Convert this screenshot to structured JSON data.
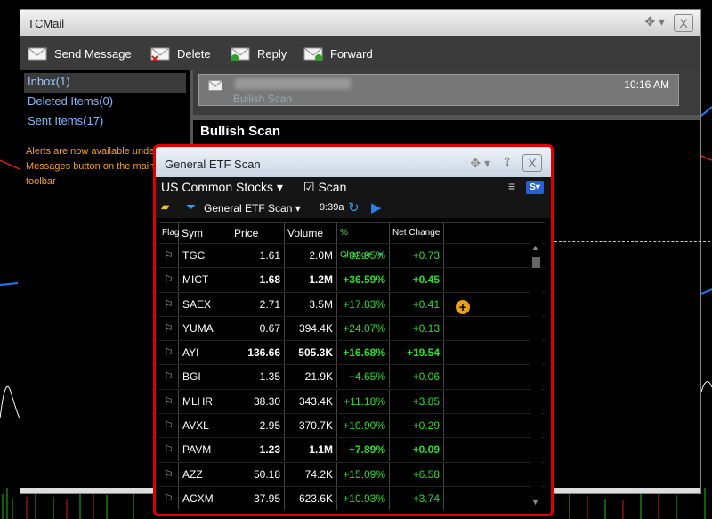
{
  "mail_window": {
    "title": "TCMail",
    "toolbar": {
      "send": "Send Message",
      "delete": "Delete",
      "reply": "Reply",
      "forward": "Forward"
    },
    "folders": [
      {
        "label": "Inbox(1)",
        "selected": true
      },
      {
        "label": "Deleted Items(0)",
        "selected": false
      },
      {
        "label": "Sent Items(17)",
        "selected": false
      }
    ],
    "alert_text": "Alerts are now available under the Messages button on the main toolbar",
    "message": {
      "subject": "Bullish Scan",
      "time": "10:16 AM"
    },
    "preview_title": "Bullish Scan"
  },
  "scan_window": {
    "title": "General ETF Scan",
    "universe": "US Common Stocks",
    "scan_checkbox_label": "Scan",
    "scan_name": "General ETF Scan",
    "time": "9:39a",
    "columns": [
      "Flag",
      "Sym",
      "Price",
      "Volume",
      "% Change",
      "Net Change"
    ],
    "rows": [
      {
        "sym": "TGC",
        "price": "1.61",
        "volume": "2.0M",
        "pct": "+82.95%",
        "net": "+0.73",
        "bold": false
      },
      {
        "sym": "MICT",
        "price": "1.68",
        "volume": "1.2M",
        "pct": "+36.59%",
        "net": "+0.45",
        "bold": true
      },
      {
        "sym": "SAEX",
        "price": "2.71",
        "volume": "3.5M",
        "pct": "+17.83%",
        "net": "+0.41",
        "bold": false
      },
      {
        "sym": "YUMA",
        "price": "0.67",
        "volume": "394.4K",
        "pct": "+24.07%",
        "net": "+0.13",
        "bold": false
      },
      {
        "sym": "AYI",
        "price": "136.66",
        "volume": "505.3K",
        "pct": "+16.68%",
        "net": "+19.54",
        "bold": true
      },
      {
        "sym": "BGI",
        "price": "1.35",
        "volume": "21.9K",
        "pct": "+4.65%",
        "net": "+0.06",
        "bold": false
      },
      {
        "sym": "MLHR",
        "price": "38.30",
        "volume": "343.4K",
        "pct": "+11.18%",
        "net": "+3.85",
        "bold": false
      },
      {
        "sym": "AVXL",
        "price": "2.95",
        "volume": "370.7K",
        "pct": "+10.90%",
        "net": "+0.29",
        "bold": false
      },
      {
        "sym": "PAVM",
        "price": "1.23",
        "volume": "1.1M",
        "pct": "+7.89%",
        "net": "+0.09",
        "bold": true
      },
      {
        "sym": "AZZ",
        "price": "50.18",
        "volume": "74.2K",
        "pct": "+15.09%",
        "net": "+6.58",
        "bold": false
      },
      {
        "sym": "ACXM",
        "price": "37.95",
        "volume": "623.6K",
        "pct": "+10.93%",
        "net": "+3.74",
        "bold": false
      }
    ]
  }
}
